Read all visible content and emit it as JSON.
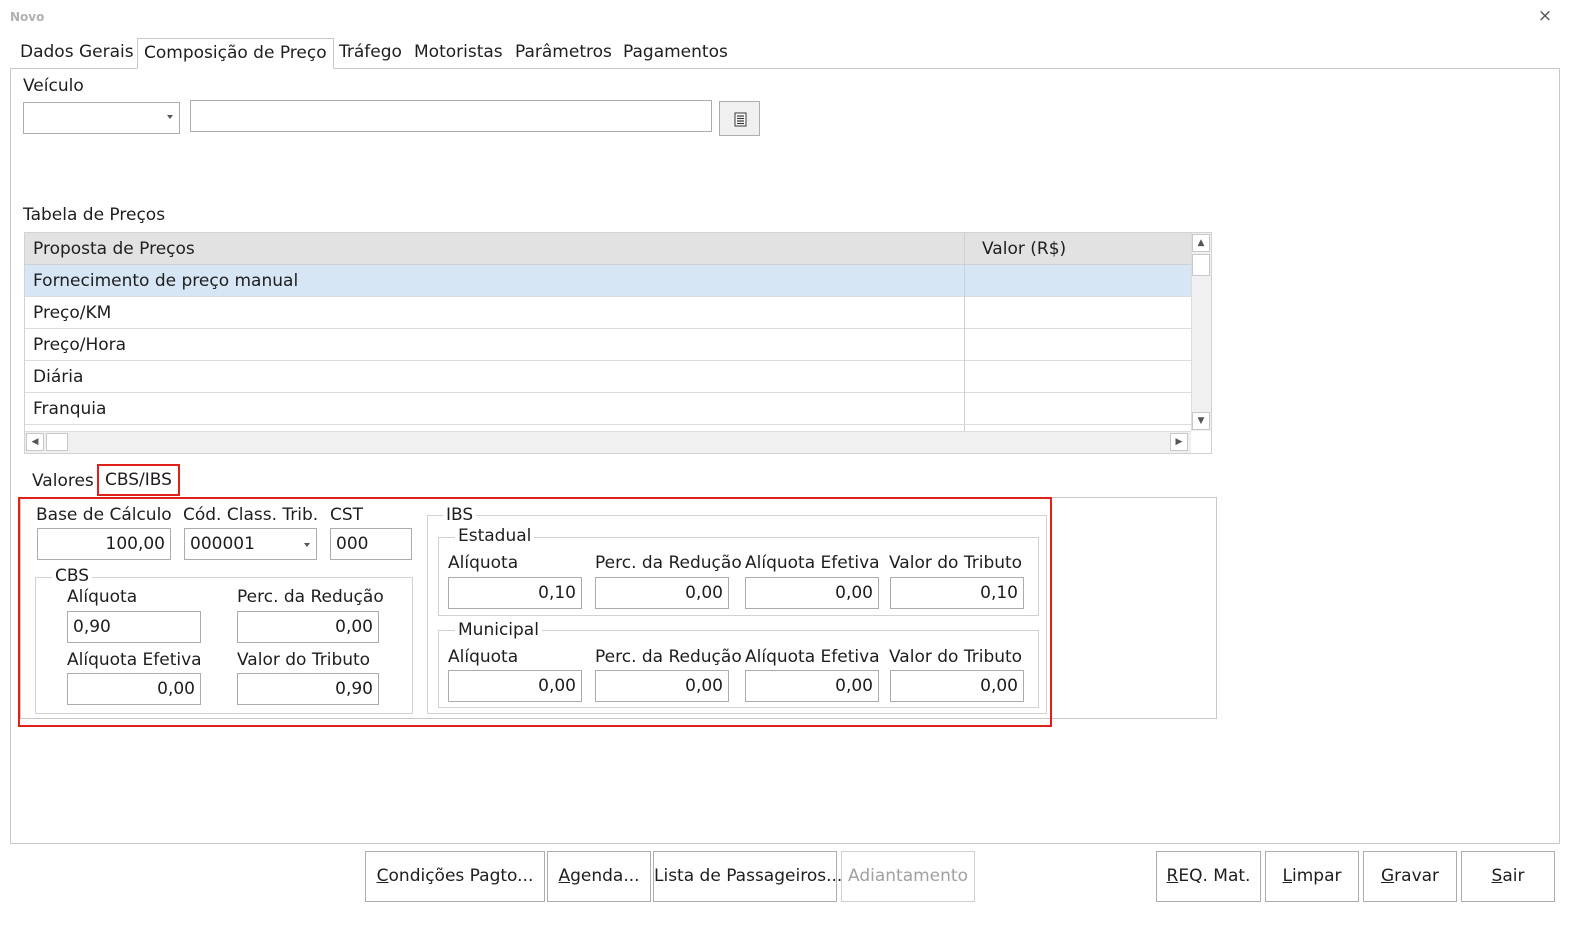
{
  "window": {
    "title": "Novo",
    "close_glyph": "×"
  },
  "tabs": [
    "Dados Gerais",
    "Composição de Preço",
    "Tráfego",
    "Motoristas",
    "Parâmetros",
    "Pagamentos"
  ],
  "veiculo": {
    "label": "Veículo",
    "combo_value": "",
    "text_value": "",
    "list_button_icon": "list-icon"
  },
  "tabela": {
    "label": "Tabela de Preços",
    "columns": [
      "Proposta de Preços",
      "Valor (R$)"
    ],
    "rows": [
      [
        "Fornecimento de preço manual",
        ""
      ],
      [
        "Preço/KM",
        ""
      ],
      [
        "Preço/Hora",
        ""
      ],
      [
        "Diária",
        ""
      ],
      [
        "Franquia",
        ""
      ]
    ],
    "selected_row": 0
  },
  "subtabs": [
    "Valores",
    "CBS/IBS"
  ],
  "cbsibs": {
    "base_calculo": {
      "label": "Base de Cálculo",
      "value": "100,00"
    },
    "cod_class_trib": {
      "label": "Cód. Class. Trib.",
      "value": "000001"
    },
    "cst": {
      "label": "CST",
      "value": "000"
    },
    "cbs": {
      "title": "CBS",
      "aliquota": {
        "label": "Alíquota",
        "value": "0,90"
      },
      "perc_reducao": {
        "label": "Perc. da Redução",
        "value": "0,00"
      },
      "aliquota_efetiva": {
        "label": "Alíquota Efetiva",
        "value": "0,00"
      },
      "valor_tributo": {
        "label": "Valor do Tributo",
        "value": "0,90"
      }
    },
    "ibs": {
      "title": "IBS",
      "estadual": {
        "title": "Estadual",
        "aliquota": {
          "label": "Alíquota",
          "value": "0,10"
        },
        "perc_reducao": {
          "label": "Perc. da Redução",
          "value": "0,00"
        },
        "aliquota_efetiva": {
          "label": "Alíquota Efetiva",
          "value": "0,00"
        },
        "valor_tributo": {
          "label": "Valor do Tributo",
          "value": "0,10"
        }
      },
      "municipal": {
        "title": "Municipal",
        "aliquota": {
          "label": "Alíquota",
          "value": "0,00"
        },
        "perc_reducao": {
          "label": "Perc. da Redução",
          "value": "0,00"
        },
        "aliquota_efetiva": {
          "label": "Alíquota Efetiva",
          "value": "0,00"
        },
        "valor_tributo": {
          "label": "Valor do Tributo",
          "value": "0,00"
        }
      }
    }
  },
  "buttons": {
    "condicoes": {
      "mnemonic": "C",
      "rest": "ondições Pagto..."
    },
    "agenda": {
      "mnemonic": "A",
      "rest": "genda..."
    },
    "lista": {
      "label": "Lista de Passageiros..."
    },
    "adiantamento": {
      "label": "Adiantamento"
    },
    "req": {
      "mnemonic": "R",
      "rest": "EQ. Mat."
    },
    "limpar": {
      "mnemonic": "L",
      "rest": "impar"
    },
    "gravar": {
      "mnemonic": "G",
      "rest": "ravar"
    },
    "sair": {
      "mnemonic": "S",
      "rest": "air"
    }
  },
  "colors": {
    "highlight_red": "#e0201a",
    "selected_row": "#d6e6f4"
  }
}
